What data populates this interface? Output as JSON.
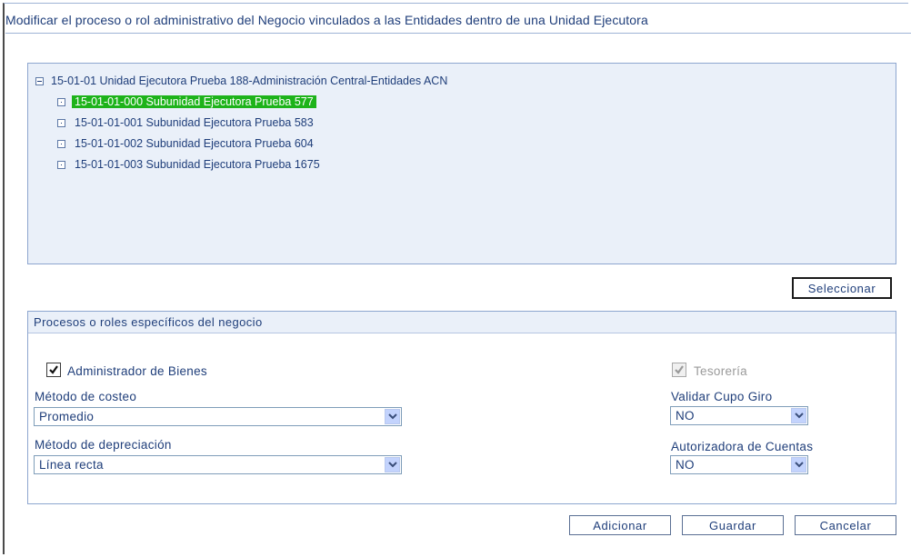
{
  "title": "Modificar el proceso o rol administrativo del Negocio vinculados a las Entidades dentro de una Unidad Ejecutora",
  "tree": {
    "root": {
      "label": "15-01-01 Unidad Ejecutora Prueba 188-Administración Central-Entidades ACN",
      "expanded": true
    },
    "children": [
      {
        "label": "15-01-01-000 Subunidad Ejecutora Prueba 577",
        "selected": true
      },
      {
        "label": "15-01-01-001 Subunidad Ejecutora Prueba 583",
        "selected": false
      },
      {
        "label": "15-01-01-002 Subunidad Ejecutora Prueba 604",
        "selected": false
      },
      {
        "label": "15-01-01-003 Subunidad Ejecutora Prueba 1675",
        "selected": false
      }
    ]
  },
  "select_button": "Seleccionar",
  "section": {
    "legend": "Procesos o roles específicos del negocio",
    "admin_bienes": {
      "label": "Administrador de Bienes",
      "checked": true
    },
    "tesoreria": {
      "label": "Tesorería",
      "checked": true,
      "disabled": true
    },
    "metodo_costeo": {
      "label": "Método de costeo",
      "value": "Promedio"
    },
    "metodo_depreciacion": {
      "label": "Método de depreciación",
      "value": "Línea recta"
    },
    "validar_cupo": {
      "label": "Validar Cupo Giro",
      "value": "NO"
    },
    "autorizadora": {
      "label": "Autorizadora de Cuentas",
      "value": "NO"
    }
  },
  "actions": {
    "add": "Adicionar",
    "save": "Guardar",
    "cancel": "Cancelar"
  },
  "colors": {
    "selected_bg": "#1db31a",
    "panel_bg": "#eaf0f9",
    "text": "#1f3e7a"
  },
  "icons": {
    "tree_expanded": "minus-box-icon",
    "tree_leaf": "dot-box-icon",
    "dropdown": "chevron-down-icon",
    "check": "check-icon"
  }
}
